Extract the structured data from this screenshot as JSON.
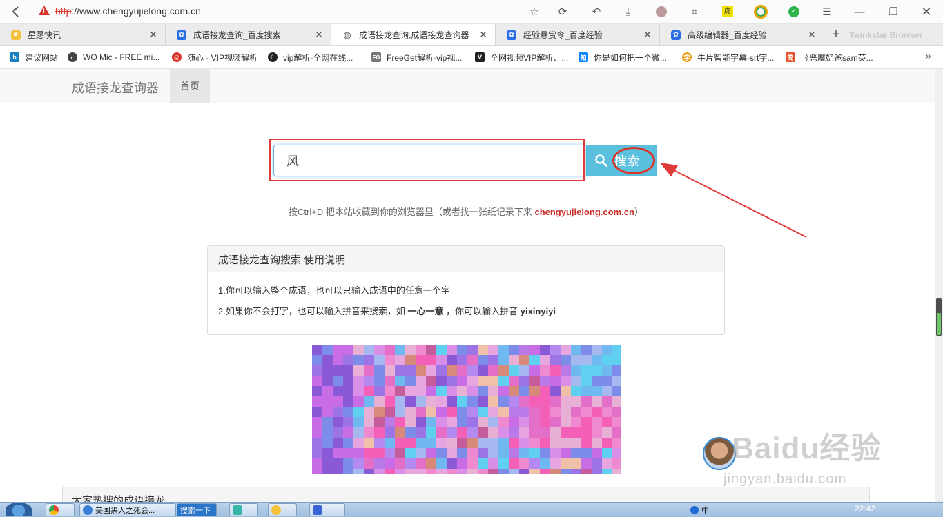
{
  "browser": {
    "url_protocol": "http",
    "url_rest": "://www.chengyujielong.com.cn",
    "brand": "Twinkstar Browser",
    "tabs": [
      {
        "label": "星愿快讯",
        "active": false
      },
      {
        "label": "成语接龙查询_百度搜索",
        "active": false
      },
      {
        "label": "成语接龙查询,成语接龙查询器",
        "active": true
      },
      {
        "label": "经验悬赏令_百度经验",
        "active": false
      },
      {
        "label": "高级编辑器_百度经验",
        "active": false
      }
    ],
    "bookmarks": [
      {
        "label": "建议网站",
        "icon_text": "b",
        "color": "#1a7fc1"
      },
      {
        "label": "WO Mic - FREE mi...",
        "icon_text": "◐",
        "color": "#444444"
      },
      {
        "label": "随心 - VIP视频解析",
        "icon_text": "◎",
        "color": "#d9352a"
      },
      {
        "label": "vip解析-全网在线...",
        "icon_text": "☾",
        "color": "#222222"
      },
      {
        "label": "FreeGet解析-vip视...",
        "icon_text": "FG",
        "color": "#777777"
      },
      {
        "label": "全网视频VIP解析、...",
        "icon_text": "V",
        "color": "#222222"
      },
      {
        "label": "你是如何把一个微...",
        "icon_text": "知",
        "color": "#0a84ff"
      },
      {
        "label": "牛片智能字幕-srt字...",
        "icon_text": "字",
        "color": "#f0a020"
      },
      {
        "label": "《恶魔奶爸sam英...",
        "icon_text": "简",
        "color": "#e8542d"
      }
    ],
    "bookmarks_more": "»"
  },
  "site": {
    "brand": "成语接龙查询器",
    "nav_home": "首页",
    "search": {
      "value": "风",
      "placeholder": "",
      "button_label": "搜索"
    },
    "tip_prefix": "按Ctrl+D 把本站收藏到你的浏览器里（或者找一张纸记录下来 ",
    "tip_site": "chengyujielong.com.cn",
    "tip_suffix": "）",
    "panel": {
      "title": "成语接龙查询搜索 使用说明",
      "line1": "1.你可以输入整个成语，也可以只输入成语中的任意一个字",
      "line2_a": "2.如果你不会打字，也可以输入拼音来搜索，如 ",
      "line2_word": "一心一意",
      "line2_b": " ，你可以输入拼音 ",
      "line2_pinyin": "yixinyiyi"
    },
    "bottom_title": "大家热搜的成语接龙"
  },
  "watermark": {
    "logo": "Baidu经验",
    "url": "jingyan.baidu.com"
  },
  "taskbar": {
    "items": [
      {
        "label": "美国黑人之死会..."
      },
      {
        "label": "搜索一下"
      }
    ],
    "tray_ime": "中",
    "clock": "22:42"
  },
  "colors": {
    "accent_button": "#5bc0de",
    "annotation_red": "#e03a3a",
    "site_red": "#c9302c"
  }
}
